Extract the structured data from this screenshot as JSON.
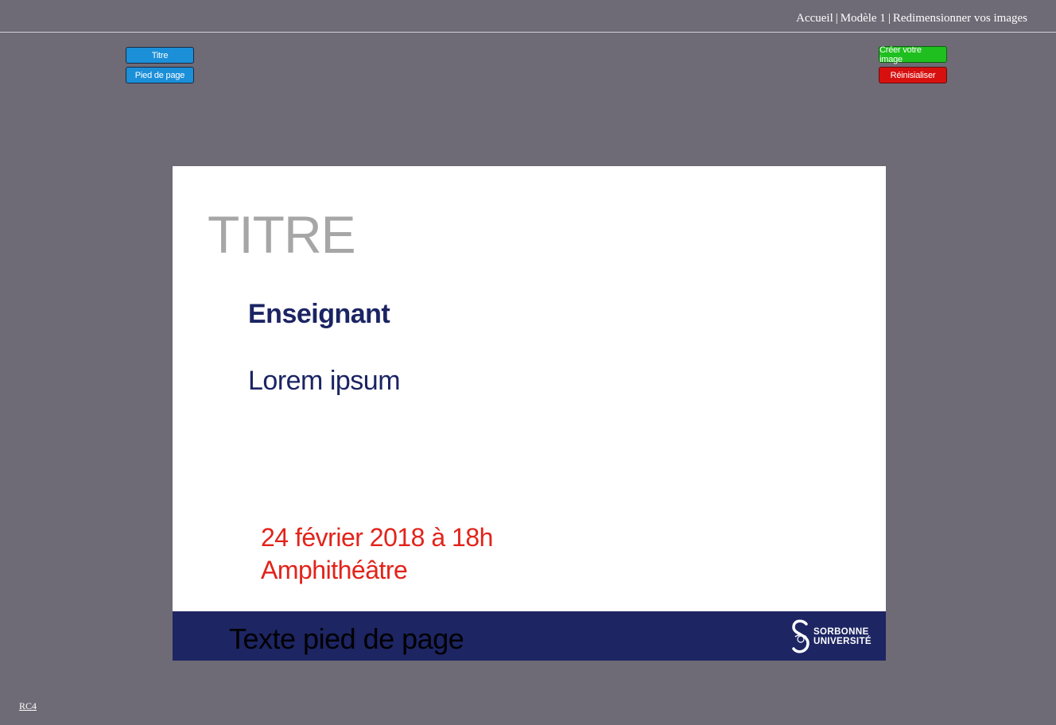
{
  "nav": {
    "home": "Accueil",
    "model": "Modèle 1",
    "resize": "Redimensionner vos images",
    "separator": "|"
  },
  "toolbar": {
    "title_button": "Titre",
    "footer_button": "Pied de page",
    "create_button": "Créer votre image",
    "reset_button": "Réinisialiser"
  },
  "slide": {
    "title": "TITRE",
    "teacher": "Enseignant",
    "subtitle": "Lorem ipsum",
    "date": "24 février 2018 à 18h",
    "place": "Amphithéâtre",
    "footer_text": "Texte pied de page",
    "logo_line1": "SORBONNE",
    "logo_line2": "UNIVERSITÉ"
  },
  "footer": {
    "version_link": "RC4"
  },
  "colors": {
    "page_background": "#6e6b76",
    "button_blue": "#1b8fd8",
    "button_green": "#1fbf1f",
    "button_red": "#d80f0f",
    "title_gray": "#a6a6a6",
    "navy": "#1d2563",
    "date_red": "#e2231a"
  }
}
